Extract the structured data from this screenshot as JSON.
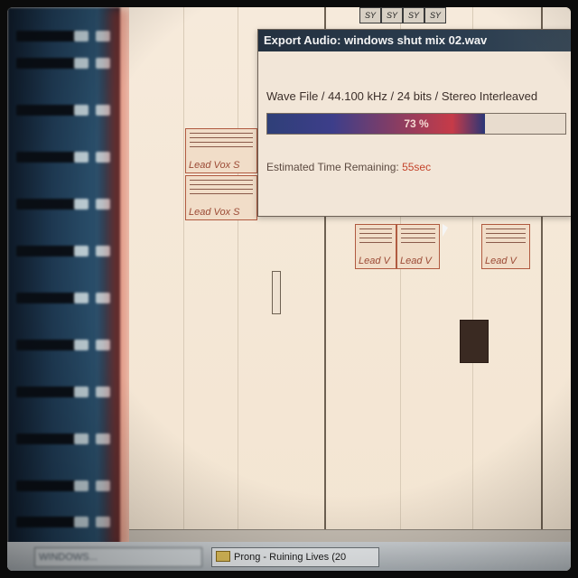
{
  "sync_buttons": [
    "SY",
    "SY",
    "SY",
    "SY"
  ],
  "clips": {
    "lead_vox_1": "Lead Vox S",
    "lead_vox_2": "Lead Vox S",
    "lead_a": "Lead V",
    "lead_b": "Lead V",
    "lead_c": "Lead V"
  },
  "dialog": {
    "title": "Export Audio: windows shut mix 02.wav",
    "format_info": "Wave File / 44.100 kHz / 24 bits / Stereo Interleaved",
    "progress": {
      "percent": 73,
      "label": "73 %"
    },
    "eta_label": "Estimated Time Remaining:",
    "eta_value": "55sec"
  },
  "taskbar": {
    "items": [
      {
        "label": "WINDOWS..."
      },
      {
        "label": "Prong - Ruining Lives (20"
      }
    ]
  },
  "colors": {
    "accent": "#c4452c",
    "titlebar": "#243140",
    "progress_fill": "#3d3e8a"
  }
}
